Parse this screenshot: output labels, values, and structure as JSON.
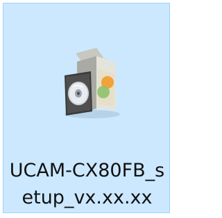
{
  "desktop_icon": {
    "icon": "setup-installer-cd-box-icon",
    "filename_line1": "UCAM-CX80FB_s",
    "filename_line2": "etup_vx.xx.xx",
    "selection_color": "#cce8ff",
    "selection_border_color": "#99d1ff"
  }
}
